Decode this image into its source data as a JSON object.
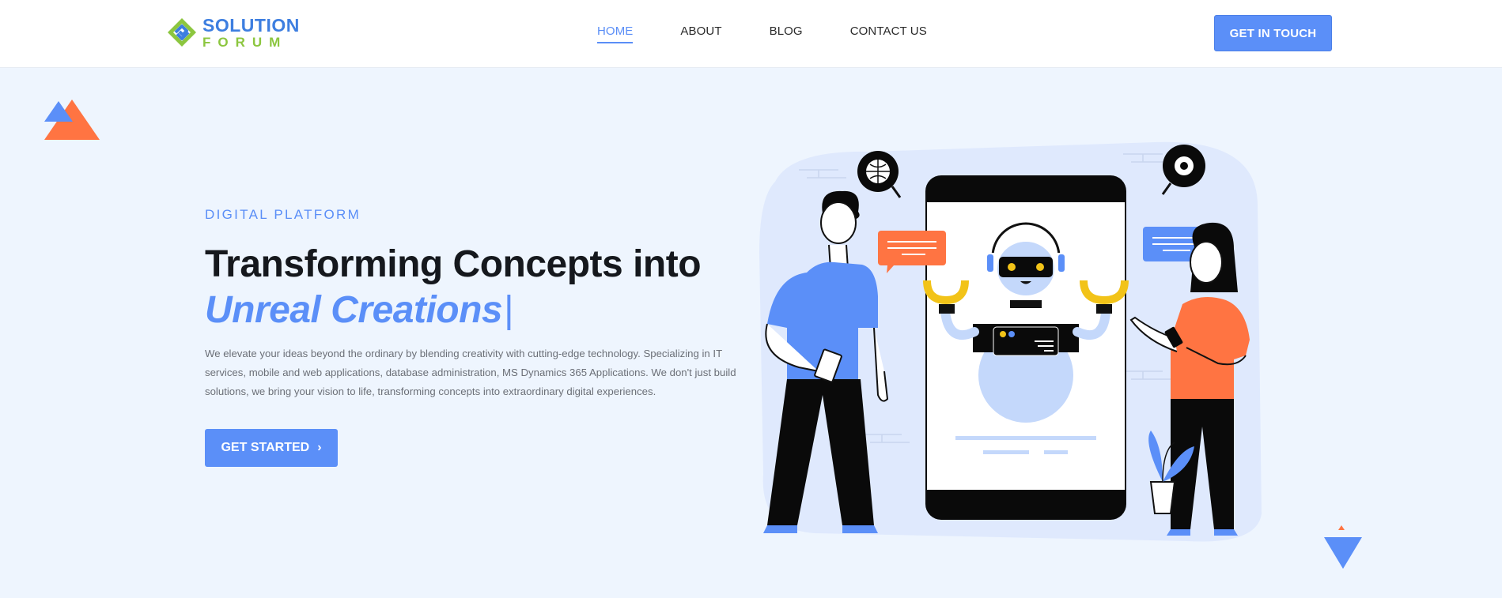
{
  "brand": {
    "line1": "SOLUTION",
    "line2": "FORUM",
    "mark_icon": "solution-forum-logo-mark",
    "colors": {
      "blue": "#3d7ee0",
      "green": "#8cc63f"
    }
  },
  "nav": {
    "items": [
      {
        "label": "HOME",
        "active": true
      },
      {
        "label": "ABOUT",
        "active": false
      },
      {
        "label": "BLOG",
        "active": false
      },
      {
        "label": "CONTACT US",
        "active": false
      }
    ]
  },
  "header": {
    "cta_label": "GET IN TOUCH"
  },
  "hero": {
    "eyebrow": "DIGITAL PLATFORM",
    "headline_line1": "Transforming Concepts into",
    "headline_line2": "Unreal Creations",
    "cursor": "|",
    "description": "We elevate your ideas beyond the ordinary by blending creativity with cutting-edge technology. Specializing in IT services, mobile and web applications, database administration, MS Dynamics 365 Applications. We don't just build solutions, we bring your vision to life, transforming concepts into extraordinary digital experiences.",
    "cta_label": "GET STARTED",
    "cta_icon": "chevron-right-icon"
  },
  "decorations": {
    "top_left": "triangles-icon",
    "bottom_right": "triangles-icon",
    "illustration": "robot-phone-illustration"
  },
  "colors": {
    "accent": "#5b8ff8",
    "hero_bg": "#eef5fe",
    "orange": "#ff7442",
    "yellow": "#f2c318",
    "robot_light": "#c4d8fb"
  }
}
